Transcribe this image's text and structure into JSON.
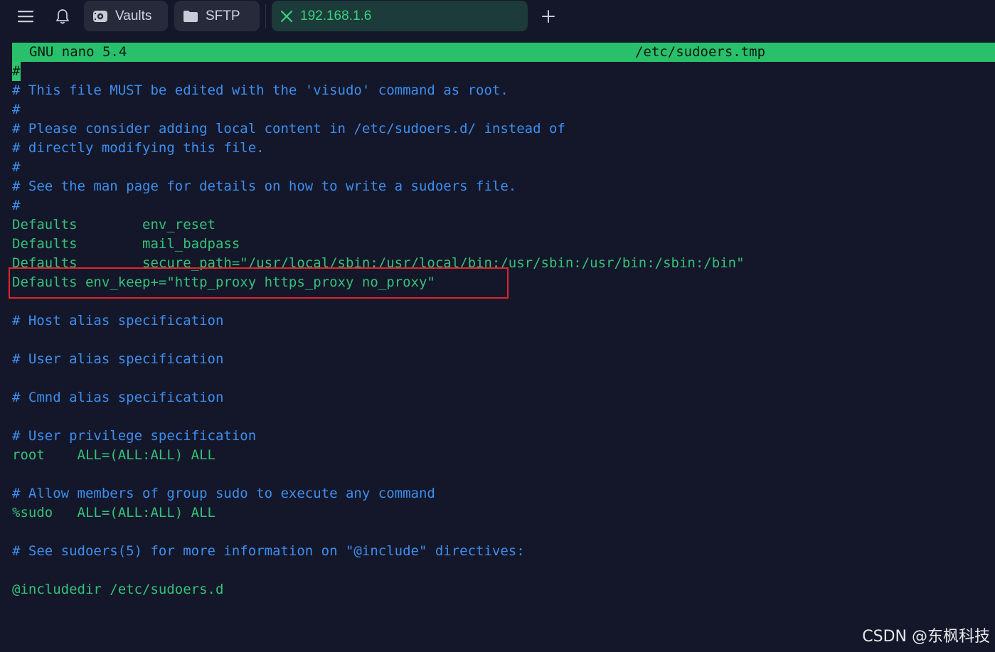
{
  "tabs": {
    "vaults_label": "Vaults",
    "sftp_label": "SFTP",
    "host_label": "192.168.1.6"
  },
  "nano": {
    "version": "GNU nano 5.4",
    "filename": "/etc/sudoers.tmp"
  },
  "file_lines": [
    {
      "text": "#",
      "kind": "cursor"
    },
    {
      "text": "# This file MUST be edited with the 'visudo' command as root.",
      "kind": "comment"
    },
    {
      "text": "#",
      "kind": "comment"
    },
    {
      "text": "# Please consider adding local content in /etc/sudoers.d/ instead of",
      "kind": "comment"
    },
    {
      "text": "# directly modifying this file.",
      "kind": "comment"
    },
    {
      "text": "#",
      "kind": "comment"
    },
    {
      "text": "# See the man page for details on how to write a sudoers file.",
      "kind": "comment"
    },
    {
      "text": "#",
      "kind": "comment"
    },
    {
      "text": "Defaults        env_reset",
      "kind": "plain"
    },
    {
      "text": "Defaults        mail_badpass",
      "kind": "plain"
    },
    {
      "text": "Defaults        secure_path=\"/usr/local/sbin:/usr/local/bin:/usr/sbin:/usr/bin:/sbin:/bin\"",
      "kind": "plain"
    },
    {
      "text": "Defaults env_keep+=\"http_proxy https_proxy no_proxy\"",
      "kind": "plain"
    },
    {
      "text": "",
      "kind": "plain"
    },
    {
      "text": "# Host alias specification",
      "kind": "comment"
    },
    {
      "text": "",
      "kind": "plain"
    },
    {
      "text": "# User alias specification",
      "kind": "comment"
    },
    {
      "text": "",
      "kind": "plain"
    },
    {
      "text": "# Cmnd alias specification",
      "kind": "comment"
    },
    {
      "text": "",
      "kind": "plain"
    },
    {
      "text": "# User privilege specification",
      "kind": "comment"
    },
    {
      "text": "root    ALL=(ALL:ALL) ALL",
      "kind": "plain"
    },
    {
      "text": "",
      "kind": "plain"
    },
    {
      "text": "# Allow members of group sudo to execute any command",
      "kind": "comment"
    },
    {
      "text": "%sudo   ALL=(ALL:ALL) ALL",
      "kind": "plain"
    },
    {
      "text": "",
      "kind": "plain"
    },
    {
      "text": "# See sudoers(5) for more information on \"@include\" directives:",
      "kind": "comment"
    },
    {
      "text": "",
      "kind": "plain"
    },
    {
      "text": "@includedir /etc/sudoers.d",
      "kind": "plain"
    }
  ],
  "watermark": "CSDN @东枫科技",
  "icons": {
    "menu": "hamburger-icon",
    "bell": "bell-icon",
    "vaults": "vault-icon",
    "sftp": "folder-icon",
    "host_close": "close-icon",
    "add": "plus-icon"
  },
  "colors": {
    "background": "#141729",
    "nano_header": "#28c06a",
    "comment": "#3d8ef0",
    "text": "#35c17a",
    "highlight_border": "#e0262b",
    "active_tab": "#1d3b3a"
  }
}
